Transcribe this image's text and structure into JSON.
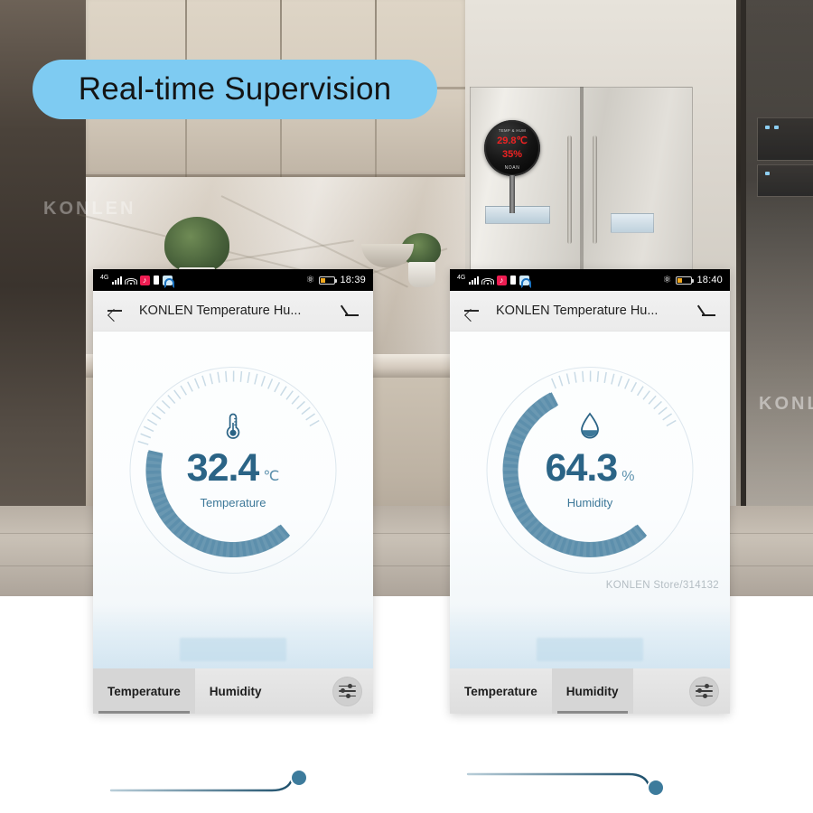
{
  "banner": {
    "text": "Real-time Supervision",
    "bg_color": "#7ecbf2",
    "text_color": "#141414"
  },
  "scene": {
    "device_display": {
      "title": "TEMP & HUM",
      "temperature": "29.8℃",
      "humidity": "35%",
      "brand": "NOAN"
    },
    "wall_watermark_1": "KONLEN",
    "wall_watermark_2": "KONLEN"
  },
  "theme": {
    "gauge_active": "#5d8fab",
    "gauge_track": "#d7e3ea",
    "value_color": "#2b6486",
    "label_color": "#3d7899",
    "accent": "#2b6486"
  },
  "phones": [
    {
      "id": "left",
      "status_bar": {
        "network": "4G",
        "time": "18:39",
        "icons": [
          "signal-bars-icon",
          "wifi-icon",
          "tiktok-icon",
          "sim-icon",
          "app-icon",
          "bluetooth-icon",
          "battery-icon"
        ]
      },
      "app_bar": {
        "back": "back-arrow-icon",
        "title": "KONLEN Temperature Hu...",
        "edit": "edit-pencil-icon"
      },
      "gauge": {
        "metric": "Temperature",
        "icon": "thermometer-icon",
        "value": "32.4",
        "unit": "℃",
        "percent": 52,
        "min": 0,
        "max": 100
      },
      "tabs": [
        {
          "label": "Temperature",
          "active": true
        },
        {
          "label": "Humidity",
          "active": false
        }
      ],
      "settings_button": "sliders-icon",
      "watermark": ""
    },
    {
      "id": "right",
      "status_bar": {
        "network": "4G",
        "time": "18:40",
        "icons": [
          "signal-bars-icon",
          "wifi-icon",
          "tiktok-icon",
          "sim-icon",
          "app-icon",
          "bluetooth-icon",
          "battery-icon"
        ]
      },
      "app_bar": {
        "back": "back-arrow-icon",
        "title": "KONLEN Temperature Hu...",
        "edit": "edit-pencil-icon"
      },
      "gauge": {
        "metric": "Humidity",
        "icon": "water-drop-icon",
        "value": "64.3",
        "unit": "%",
        "percent": 70,
        "min": 0,
        "max": 100
      },
      "tabs": [
        {
          "label": "Temperature",
          "active": false
        },
        {
          "label": "Humidity",
          "active": true
        }
      ],
      "settings_button": "sliders-icon",
      "watermark": "KONLEN Store/314132"
    }
  ],
  "progress_indicators": [
    {
      "id": "left",
      "direction": "up",
      "dot_color": "#3d7b9c"
    },
    {
      "id": "right",
      "direction": "down",
      "dot_color": "#3d7b9c"
    }
  ]
}
